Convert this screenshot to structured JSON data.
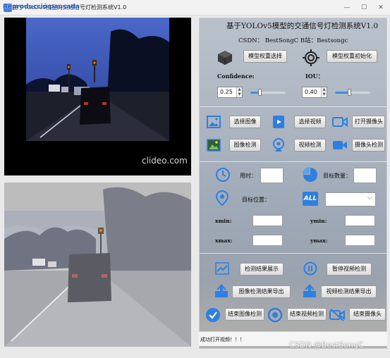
{
  "window": {
    "title": "基于YOLOv5模型的交通信号灯检测系统V1.0",
    "watermark": "Reproducció pausada",
    "controls": [
      "—",
      "☐",
      "✕"
    ]
  },
  "video_panel": {
    "overlay_text": "clideo.com"
  },
  "panel": {
    "title": "基于YOLOv5模型的交通信号灯检测系统V1.0",
    "subtitle": "CSDN：  BestSongC  B站：Bestsongc",
    "load_model_btn": "模型权重选择",
    "init_model_btn": "模型权重初始化",
    "confidence_label": "Confidence:",
    "iou_label": "IOU：",
    "confidence_value": "0.25",
    "confidence_level": 0.25,
    "iou_value": "0.40",
    "iou_level": 0.4,
    "select_image_btn": "选择图像",
    "select_video_btn": "选择视频",
    "open_camera_btn": "打开摄像头",
    "image_detect_btn": "图像检测",
    "video_detect_btn": "视频检测",
    "camera_detect_btn": "摄像头检测",
    "time_label": "用时：",
    "target_count_label": "目标数量：",
    "target_pos_label": "目标位置：",
    "all_icon_text": "ALL",
    "xmin_label": "xmin:",
    "ymin_label": "ymin:",
    "xmax_label": "xmax:",
    "ymax_label": "ymax:",
    "show_result_btn": "检测结果展示",
    "pause_video_btn": "暂停视频检测",
    "export_image_btn": "图像检测结果导出",
    "export_video_btn": "视频检测结果导出",
    "end_image_btn": "结束图像检测",
    "end_video_btn": "结束视频检测",
    "end_camera_btn": "结束摄像头"
  },
  "status": {
    "text": "成功打开视频！！！"
  },
  "csdn_watermark": "CSDN @BestSongC",
  "colors": {
    "icon_blue": "#2f7fe0",
    "accent": "#3d8ee6"
  }
}
